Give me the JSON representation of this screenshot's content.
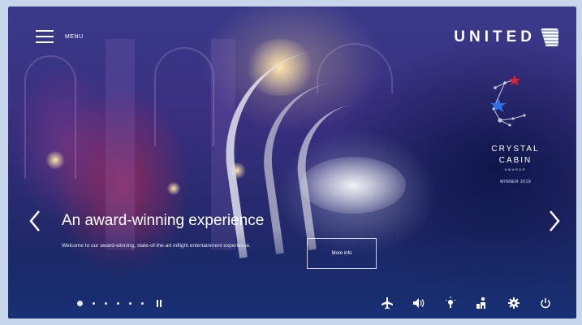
{
  "menu": {
    "label": "MENU",
    "icon": "hamburger-icon"
  },
  "brand": {
    "name": "UNITED",
    "icon": "globe-logo-icon"
  },
  "award": {
    "line1": "CRYSTAL",
    "line2": "CABIN",
    "line3": "AWARD®",
    "line4": "WINNER 2019",
    "star_colors": [
      "#e0202e",
      "#2e6fe8",
      "#c8ccd8"
    ]
  },
  "slide": {
    "headline": "An award-winning experience",
    "description": "Welcome to our award-winning, state-of-the-art inflight entertainment experience.",
    "button_label": "More info"
  },
  "carousel": {
    "slide_count": 6,
    "active_index": 0,
    "prev_icon": "chevron-left-icon",
    "next_icon": "chevron-right-icon",
    "pause_icon": "pause-icon"
  },
  "toolbar": {
    "items": [
      {
        "name": "airplane-icon"
      },
      {
        "name": "volume-icon"
      },
      {
        "name": "reading-light-icon"
      },
      {
        "name": "attendant-call-icon"
      },
      {
        "name": "settings-gear-icon"
      },
      {
        "name": "power-icon"
      }
    ]
  },
  "colors": {
    "text": "#ffffff",
    "page_background": "#c8d6ec"
  }
}
